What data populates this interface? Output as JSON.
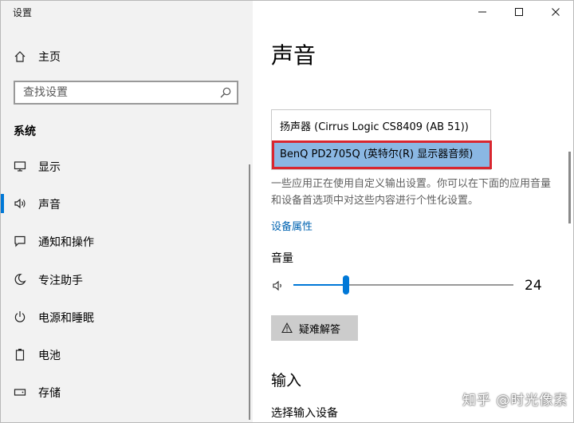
{
  "window": {
    "title": "设置",
    "controls": {
      "minimize": "minimize-icon",
      "maximize": "maximize-icon",
      "close": "close-icon"
    }
  },
  "sidebar": {
    "home_label": "主页",
    "search": {
      "placeholder": "查找设置",
      "value": ""
    },
    "section_title": "系统",
    "items": [
      {
        "label": "显示",
        "icon": "monitor-icon",
        "selected": false
      },
      {
        "label": "声音",
        "icon": "speaker-icon",
        "selected": true
      },
      {
        "label": "通知和操作",
        "icon": "notification-icon",
        "selected": false
      },
      {
        "label": "专注助手",
        "icon": "moon-icon",
        "selected": false
      },
      {
        "label": "电源和睡眠",
        "icon": "power-icon",
        "selected": false
      },
      {
        "label": "电池",
        "icon": "battery-icon",
        "selected": false
      },
      {
        "label": "存储",
        "icon": "storage-icon",
        "selected": false
      }
    ]
  },
  "main": {
    "title": "声音",
    "output_devices": [
      "扬声器 (Cirrus Logic CS8409 (AB 51))",
      "BenQ PD2705Q (英特尔(R) 显示器音频)"
    ],
    "selected_device_index": 1,
    "description": "一些应用正在使用自定义输出设置。你可以在下面的应用音量和设备首选项中对这些内容进行个性化设置。",
    "device_properties_link": "设备属性",
    "volume": {
      "label": "音量",
      "value": 24,
      "max": 100
    },
    "troubleshoot_label": "疑难解答",
    "input_heading": "输入",
    "input_device_label": "选择输入设备"
  },
  "watermark": "知乎 @时光像素",
  "colors": {
    "accent": "#0078d7",
    "sidebar_bg": "#f2f2f2",
    "selected_option_bg": "#8ab7e3",
    "highlight_border": "#d9262f",
    "link": "#0063b1"
  }
}
